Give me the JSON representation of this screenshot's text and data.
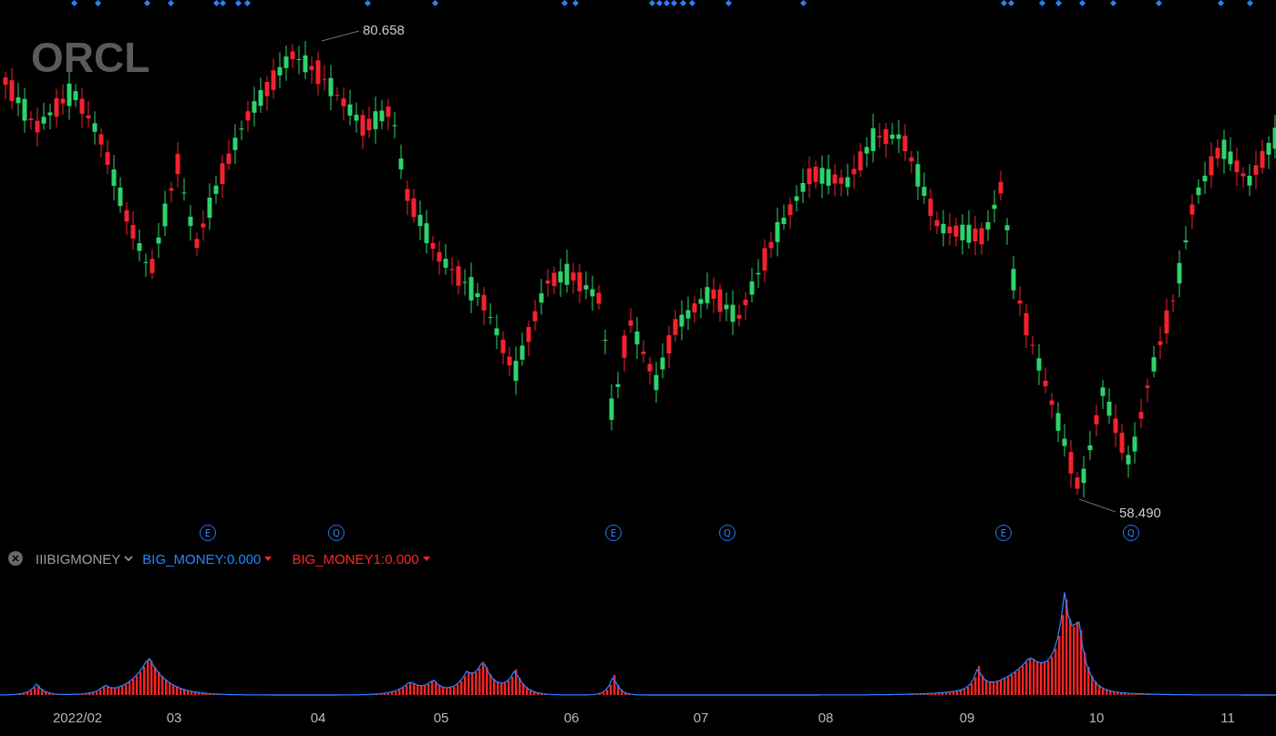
{
  "symbol": "ORCL",
  "price_labels": [
    {
      "kind": "high",
      "text": "80.658"
    },
    {
      "kind": "low",
      "text": "58.490"
    }
  ],
  "events": [
    {
      "label": "E"
    },
    {
      "label": "Q"
    },
    {
      "label": "E"
    },
    {
      "label": "Q"
    },
    {
      "label": "E"
    },
    {
      "label": "Q"
    }
  ],
  "indicator": {
    "name": "IIIBIGMONEY",
    "values": [
      {
        "text": "BIG_MONEY:0.000",
        "color": "#1e88ff"
      },
      {
        "text": "BIG_MONEY1:0.000",
        "color": "#ff2424"
      }
    ]
  },
  "x_axis": [
    "2022/02",
    "03",
    "04",
    "05",
    "06",
    "07",
    "08",
    "09",
    "10",
    "11"
  ]
}
